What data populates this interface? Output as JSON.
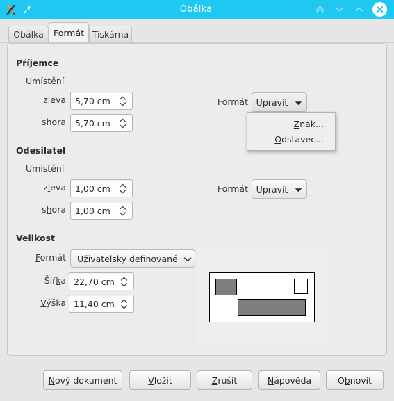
{
  "titlebar": {
    "title": "Obálka",
    "app_icon": "libreoffice-writer-icon",
    "pin_icon": "pin-icon",
    "shade_icon": "double-chevron-up-icon",
    "minimize_icon": "chevron-down-icon",
    "maximize_icon": "chevron-up-icon",
    "close_icon": "close-icon",
    "accent_color": "#1ec8f0"
  },
  "tabs": [
    {
      "label": "Obálka",
      "active": false
    },
    {
      "label": "Formát",
      "active": true
    },
    {
      "label": "Tiskárna",
      "active": false
    }
  ],
  "recipient": {
    "group_title": "Příjemce",
    "sub_label": "Umístění",
    "left_label_pre": "z",
    "left_label_accel": "l",
    "left_label_post": "eva",
    "left_value": "5,70 cm",
    "top_label_pre": "",
    "top_label_accel": "s",
    "top_label_post": "hora",
    "top_value": "5,70 cm",
    "format_label_pre": "F",
    "format_label_accel": "o",
    "format_label_post": "rmát",
    "format_button": "Upravit"
  },
  "sender": {
    "group_title": "Odesilatel",
    "sub_label": "Umístění",
    "left_label_pre": "z",
    "left_label_accel": "l",
    "left_label_post": "eva",
    "left_value": "1,00 cm",
    "top_label_pre": "s",
    "top_label_accel": "h",
    "top_label_post": "ora",
    "top_value": "1,00 cm",
    "format_label_pre": "Fo",
    "format_label_accel": "r",
    "format_label_post": "mát",
    "format_button": "Upravit"
  },
  "menu": {
    "items": [
      {
        "pre": "",
        "accel": "Z",
        "post": "nak..."
      },
      {
        "pre": "",
        "accel": "O",
        "post": "dstavec..."
      }
    ]
  },
  "size": {
    "group_title": "Velikost",
    "format_label_pre": "",
    "format_label_accel": "F",
    "format_label_post": "ormát",
    "format_value": "Uživatelsky definované",
    "width_label_pre": "Šíř",
    "width_label_accel": "k",
    "width_label_post": "a",
    "width_value": "22,70 cm",
    "height_label_pre": "",
    "height_label_accel": "V",
    "height_label_post": "ýška",
    "height_value": "11,40 cm"
  },
  "preview": {
    "name": "envelope-preview",
    "sender_box": "sender-area",
    "stamp_box": "stamp-area",
    "recipient_box": "recipient-area"
  },
  "buttons": [
    {
      "pre": "",
      "accel": "N",
      "post": "ový dokument"
    },
    {
      "pre": "",
      "accel": "V",
      "post": "ložit"
    },
    {
      "pre": "",
      "accel": "Z",
      "post": "rušit"
    },
    {
      "pre": "",
      "accel": "N",
      "post": "ápověda"
    },
    {
      "pre": "O",
      "accel": "b",
      "post": "novit"
    }
  ]
}
